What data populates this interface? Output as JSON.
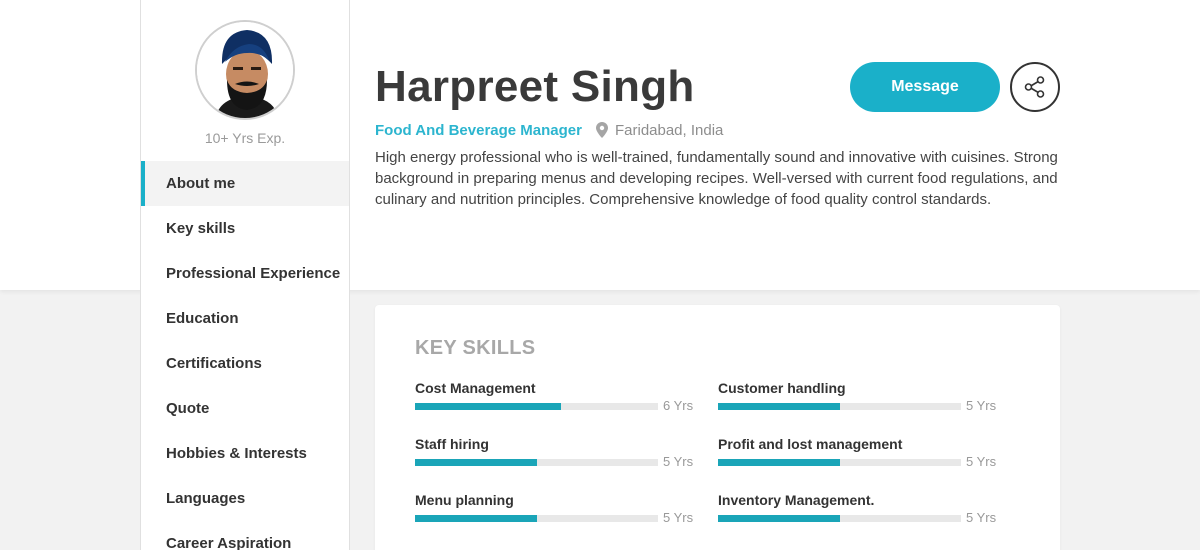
{
  "profile": {
    "name": "Harpreet Singh",
    "role": "Food And Beverage Manager",
    "location": "Faridabad, India",
    "experience": "10+ Yrs Exp.",
    "bio": "High energy professional who is well-trained, fundamentally sound and innovative with cuisines. Strong background in preparing menus and developing recipes. Well-versed with current food regulations, and culinary and nutrition principles. Comprehensive knowledge of food quality control standards."
  },
  "actions": {
    "message_label": "Message"
  },
  "nav": {
    "items": [
      {
        "label": "About me"
      },
      {
        "label": "Key skills"
      },
      {
        "label": "Professional Experience"
      },
      {
        "label": "Education"
      },
      {
        "label": "Certifications"
      },
      {
        "label": "Quote"
      },
      {
        "label": "Hobbies & Interests"
      },
      {
        "label": "Languages"
      },
      {
        "label": "Career Aspiration"
      }
    ],
    "active_index": 0
  },
  "key_skills": {
    "title": "KEY SKILLS",
    "skills": [
      {
        "name": "Cost Management",
        "years": "6 Yrs",
        "level": 0.6
      },
      {
        "name": "Customer handling",
        "years": "5 Yrs",
        "level": 0.5
      },
      {
        "name": "Staff hiring",
        "years": "5 Yrs",
        "level": 0.5
      },
      {
        "name": "Profit and lost management",
        "years": "5 Yrs",
        "level": 0.5
      },
      {
        "name": "Menu planning",
        "years": "5 Yrs",
        "level": 0.5
      },
      {
        "name": "Inventory Management.",
        "years": "5 Yrs",
        "level": 0.5
      }
    ]
  },
  "colors": {
    "accent": "#1ab0c9",
    "role_text": "#2cb5cf",
    "skill_bar": "#1aa5b8"
  },
  "icons": {
    "share": "share-icon",
    "location": "map-pin-icon"
  }
}
